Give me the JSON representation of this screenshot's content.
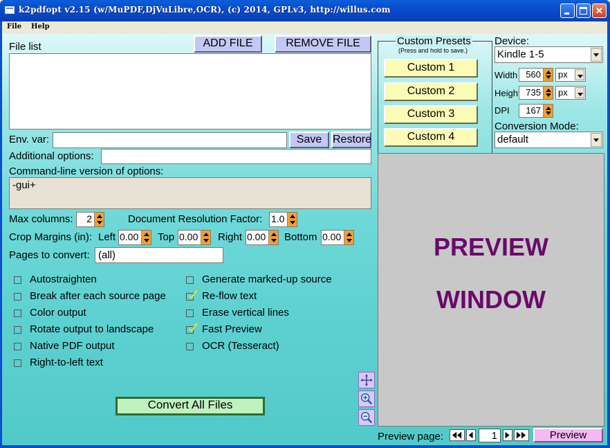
{
  "titlebar": {
    "title": "k2pdfopt v2.15 (w/MuPDF,DjVuLibre,OCR), (c) 2014, GPLv3, http://willus.com",
    "icons": [
      "app-icon",
      "minimize-icon",
      "maximize-icon",
      "close-icon"
    ]
  },
  "menu": {
    "file": "File",
    "help": "Help"
  },
  "filelist": {
    "label": "File list",
    "add_button": "ADD FILE",
    "remove_button": "REMOVE FILE"
  },
  "env": {
    "label": "Env. var:",
    "value": "",
    "save": "Save",
    "restore": "Restore"
  },
  "additional": {
    "label": "Additional options:",
    "value": ""
  },
  "cmdline": {
    "label": "Command-line version of options:",
    "value": "-gui+"
  },
  "max_columns": {
    "label": "Max columns:",
    "value": "2"
  },
  "doc_res": {
    "label": "Document Resolution Factor:",
    "value": "1.0"
  },
  "crop": {
    "label": "Crop Margins (in):",
    "left_label": "Left",
    "left": "0.00",
    "top_label": "Top",
    "top": "0.00",
    "right_label": "Right",
    "right": "0.00",
    "bottom_label": "Bottom",
    "bottom": "0.00"
  },
  "pages": {
    "label": "Pages to convert:",
    "value": "(all)"
  },
  "options_left": [
    {
      "label": "Autostraighten",
      "checked": false
    },
    {
      "label": "Break after each source page",
      "checked": false
    },
    {
      "label": "Color output",
      "checked": false
    },
    {
      "label": "Rotate output to landscape",
      "checked": false
    },
    {
      "label": "Native PDF output",
      "checked": false
    },
    {
      "label": "Right-to-left text",
      "checked": false
    }
  ],
  "options_right": [
    {
      "label": "Generate marked-up source",
      "checked": false
    },
    {
      "label": "Re-flow text",
      "checked": true
    },
    {
      "label": "Erase vertical lines",
      "checked": false
    },
    {
      "label": "Fast Preview",
      "checked": true
    },
    {
      "label": "OCR (Tesseract)",
      "checked": false
    }
  ],
  "convert_button": "Convert All Files",
  "presets": {
    "title": "Custom Presets",
    "hint": "(Press and hold to save.)",
    "buttons": [
      "Custom 1",
      "Custom 2",
      "Custom 3",
      "Custom 4"
    ]
  },
  "device": {
    "label": "Device:",
    "value": "Kindle 1-5",
    "width_label": "Width",
    "width": "560",
    "width_unit": "px",
    "height_label": "Height",
    "height": "735",
    "height_unit": "px",
    "dpi_label": "DPI",
    "dpi": "167"
  },
  "conversion": {
    "label": "Conversion Mode:",
    "value": "default"
  },
  "preview": {
    "line1": "PREVIEW",
    "line2": "WINDOW",
    "page_label": "Preview page:",
    "page": "1",
    "button": "Preview",
    "text_color": "#6a0a6a",
    "bg_color": "#c8c8c8"
  },
  "tools": [
    "move-icon",
    "zoom-in-icon",
    "zoom-out-icon"
  ]
}
